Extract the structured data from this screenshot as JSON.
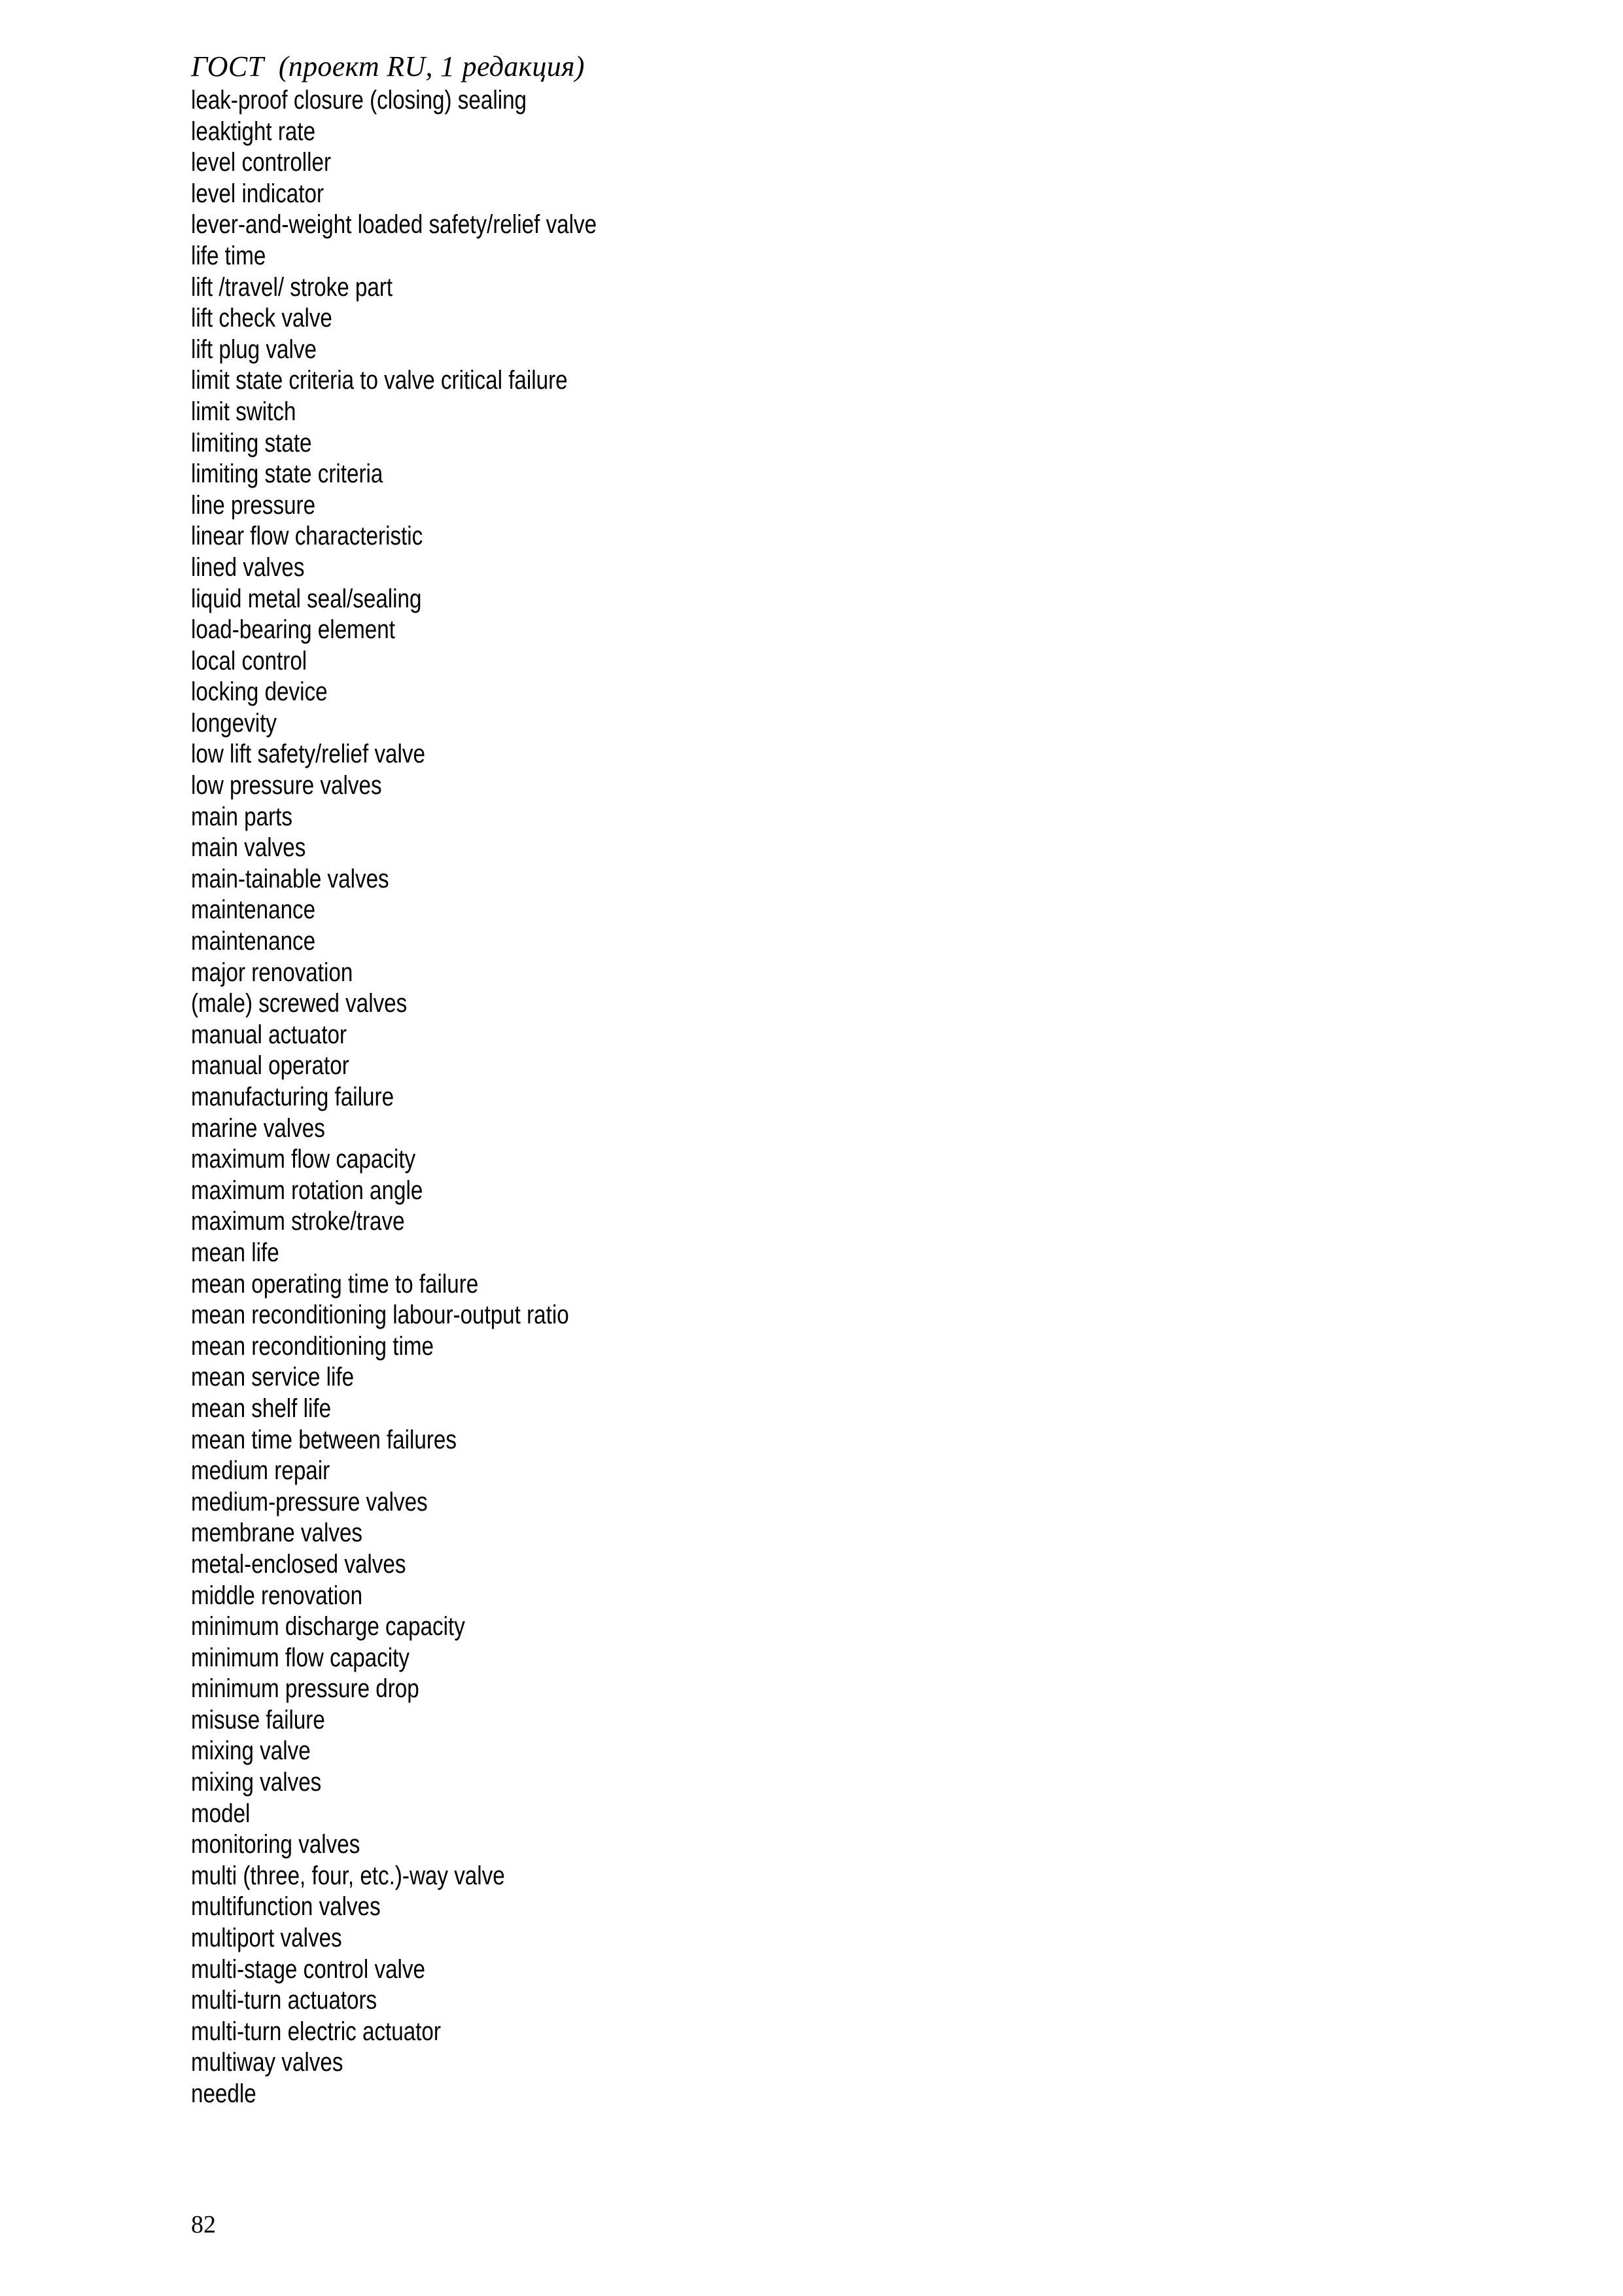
{
  "document": {
    "header": "ГОСТ  (проект RU, 1 редакция)",
    "page_number": "82",
    "text_color": "#000000",
    "background_color": "#ffffff"
  },
  "terms": [
    "leak-proof closure (closing) sealing",
    "leaktight rate",
    "level controller",
    "level indicator",
    "lever-and-weight loaded safety/relief valve",
    "life time",
    "lift /travel/ stroke part",
    "lift check valve",
    "lift plug valve",
    "limit state criteria to valve critical failure",
    "limit switch",
    "limiting state",
    "limiting state criteria",
    "line pressure",
    "linear flow characteristic",
    "lined valves",
    "liquid metal seal/sealing",
    "load-bearing element",
    "local control",
    "locking device",
    "longevity",
    "low lift safety/relief valve",
    "low pressure valves",
    "main parts",
    "main valves",
    "main-tainable valves",
    "maintenance",
    "maintenance",
    "major renovation",
    "(male) screwed valves",
    "manual actuator",
    "manual operator",
    "manufacturing failure",
    "marine valves",
    "maximum flow capacity",
    "maximum rotation angle",
    "maximum stroke/trave",
    "mean life",
    "mean operating time to failure",
    "mean reconditioning labour-output ratio",
    "mean reconditioning time",
    "mean service life",
    "mean shelf life",
    "mean time between failures",
    "medium repair",
    "medium-pressure valves",
    "membrane valves",
    "metal-enclosed valves",
    "middle renovation",
    "minimum discharge capacity",
    "minimum flow capacity",
    "minimum pressure drop",
    "misuse failure",
    "mixing valve",
    "mixing valves",
    "model",
    "monitoring valves",
    "multi (three, four, etc.)-way valve",
    "multifunction valves",
    "multiport valves",
    "multi-stage control valve",
    "multi-turn actuators",
    "multi-turn electric actuator",
    "multiway valves",
    "needle"
  ]
}
